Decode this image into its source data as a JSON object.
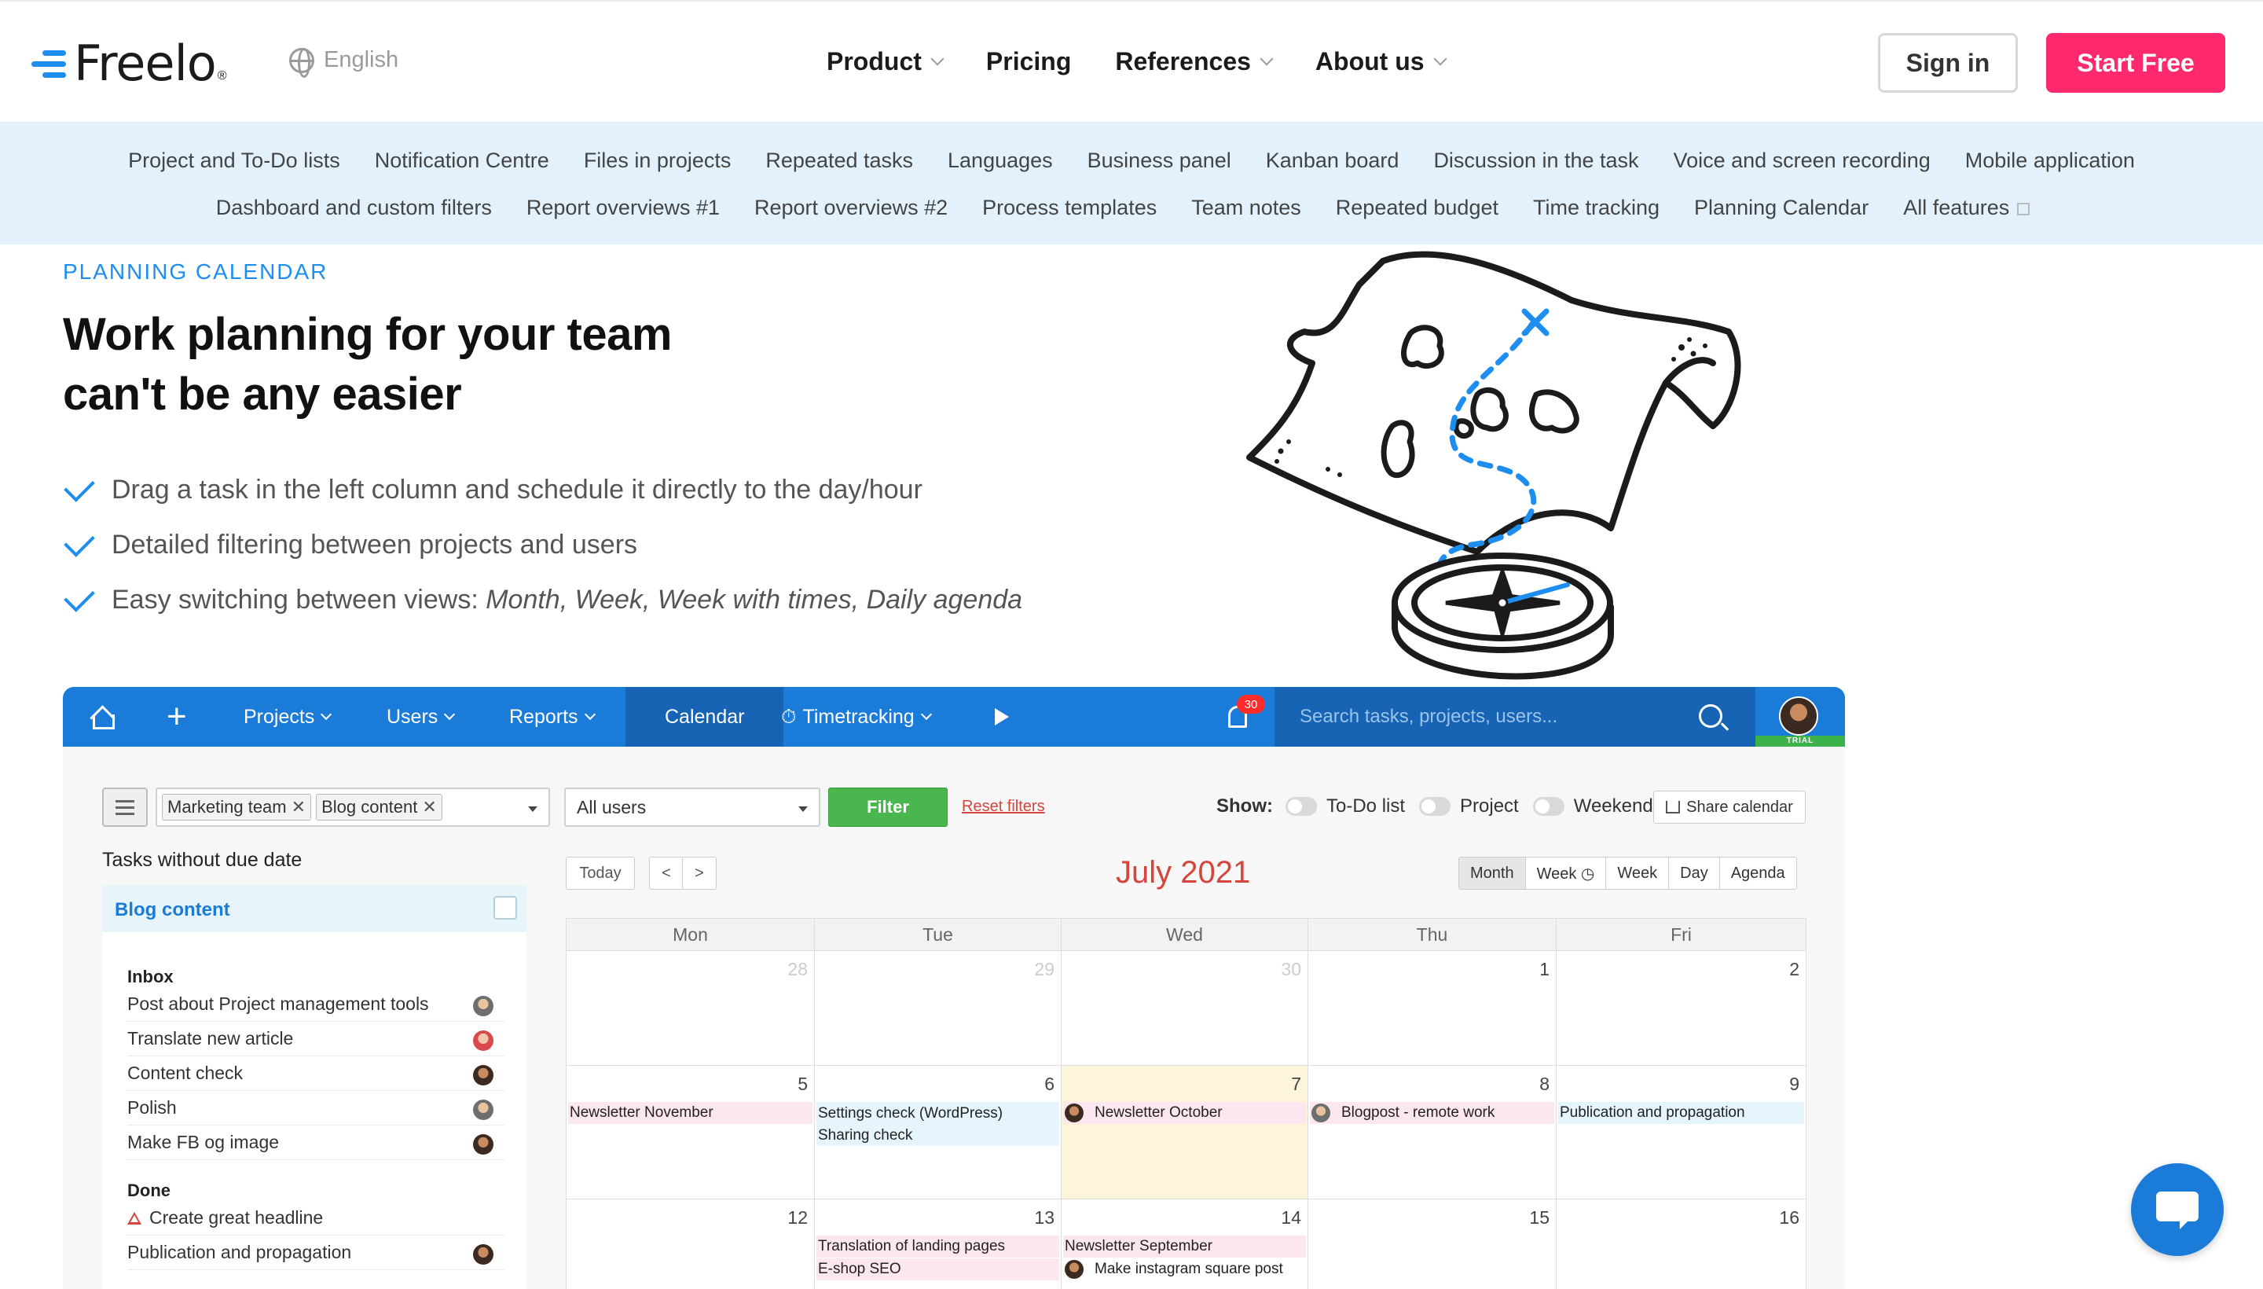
{
  "brand": {
    "name": "Freelo",
    "reg": "®",
    "accent": "#1d8ef0",
    "cta_color": "#ff2a6d"
  },
  "topnav": {
    "language": "English",
    "menu": [
      {
        "label": "Product",
        "dropdown": true
      },
      {
        "label": "Pricing",
        "dropdown": false
      },
      {
        "label": "References",
        "dropdown": true
      },
      {
        "label": "About us",
        "dropdown": true
      }
    ],
    "sign_in": "Sign in",
    "start_free": "Start Free"
  },
  "features": {
    "row1": [
      "Project and To-Do lists",
      "Notification Centre",
      "Files in projects",
      "Repeated tasks",
      "Languages",
      "Business panel",
      "Kanban board",
      "Discussion in the task",
      "Voice and screen recording",
      "Mobile application"
    ],
    "row2": [
      "Dashboard and custom filters",
      "Report overviews #1",
      "Report overviews #2",
      "Process templates",
      "Team notes",
      "Repeated budget",
      "Time tracking",
      "Planning Calendar",
      "All features"
    ]
  },
  "hero": {
    "eyebrow": "PLANNING CALENDAR",
    "title_line1": "Work planning for your team",
    "title_line2": "can't be any easier",
    "check1": "Drag a task in the left column and schedule it directly to the day/hour",
    "check2": "Detailed filtering between projects and users",
    "check3_prefix": "Easy switching between views: ",
    "check3_em": "Month, Week, Week with times, Daily agenda"
  },
  "app": {
    "nav": {
      "projects": "Projects",
      "users": "Users",
      "reports": "Reports",
      "calendar": "Calendar",
      "timetracking": "Timetracking",
      "notifications": "30",
      "search_placeholder": "Search tasks, projects, users...",
      "trial": "TRIAL"
    },
    "filters": {
      "tag1": "Marketing team",
      "tag2": "Blog content",
      "users": "All users",
      "filter_btn": "Filter",
      "reset": "Reset filters",
      "show_label": "Show:",
      "opt_todo": "To-Do list",
      "opt_project": "Project",
      "opt_weekend": "Weekend",
      "share": "Share calendar"
    },
    "left": {
      "title": "Tasks without due date",
      "project": "Blog content",
      "inbox_label": "Inbox",
      "inbox": [
        "Post about Project management tools",
        "Translate new article",
        "Content check",
        "Polish",
        "Make FB og image"
      ],
      "done_label": "Done",
      "done": [
        "Create great headline",
        "Publication and propagation"
      ]
    },
    "calendar": {
      "today": "Today",
      "prev": "<",
      "next": ">",
      "title": "July 2021",
      "views": [
        "Month",
        "Week ◷",
        "Week",
        "Day",
        "Agenda"
      ],
      "days": [
        "Mon",
        "Tue",
        "Wed",
        "Thu",
        "Fri"
      ],
      "week1": [
        "28",
        "29",
        "30",
        "1",
        "2"
      ],
      "week2": [
        "5",
        "6",
        "7",
        "8",
        "9"
      ],
      "week3": [
        "12",
        "13",
        "14",
        "15",
        "16"
      ],
      "events": {
        "w2_mon": "Newsletter November",
        "w2_tue_1": "Settings check (WordPress)",
        "w2_tue_2": "Sharing check",
        "w2_wed": "Newsletter October",
        "w2_thu": "Blogpost - remote work",
        "w2_fri": "Publication and propagation",
        "w3_tue_1": "Translation of landing pages",
        "w3_tue_2": "E-shop SEO",
        "w3_wed_1": "Newsletter September",
        "w3_wed_2": "Make instagram square post"
      },
      "colors": {
        "pink": "#fde7ee",
        "blue": "#e6f4fb",
        "today": "#fdf5d9"
      }
    }
  }
}
